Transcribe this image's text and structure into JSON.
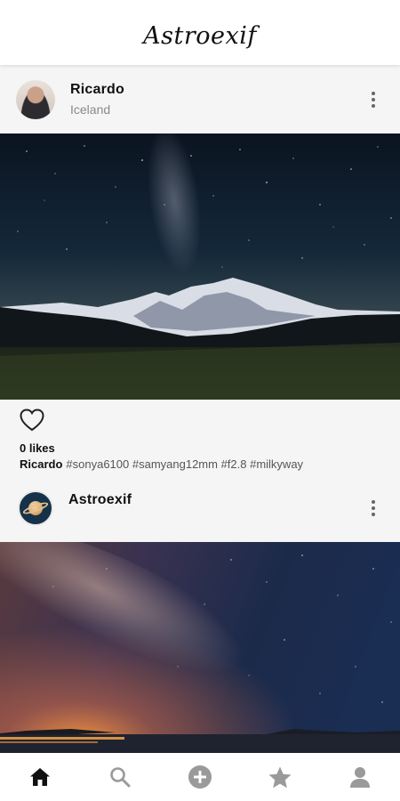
{
  "app": {
    "title": "Astroexif"
  },
  "posts": [
    {
      "username": "Ricardo",
      "location": "Iceland",
      "likes_text": "0 likes",
      "caption_user": "Ricardo",
      "caption_tags": "#sonya6100 #samyang12mm #f2.8 #milkyway"
    },
    {
      "username": "Astroexif",
      "location": ""
    }
  ],
  "icons": {
    "more": "more-vertical-icon",
    "like": "heart-outline-icon",
    "nav": [
      "home-icon",
      "search-icon",
      "add-circle-icon",
      "star-icon",
      "person-icon"
    ]
  },
  "colors": {
    "header_bg": "#ffffff",
    "feed_bg": "#f5f5f5",
    "nav_active": "#111111",
    "nav_inactive": "#9a9a9a",
    "secondary_text": "#8a8a8a"
  },
  "nav": {
    "active_index": 0
  }
}
